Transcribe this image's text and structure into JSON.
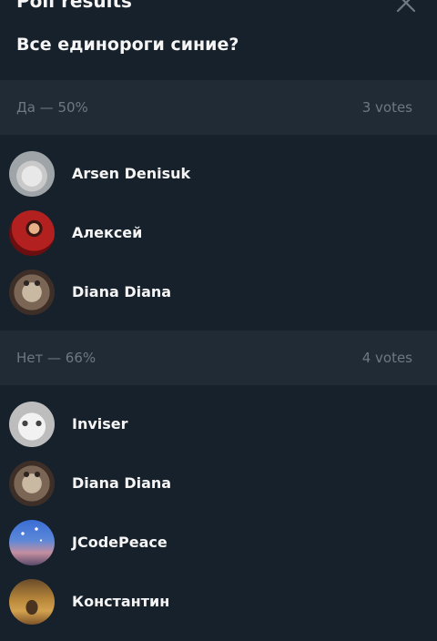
{
  "header": {
    "title": "Poll results",
    "question": "Все единороги синие?"
  },
  "sections": [
    {
      "option_label": "Да — 50%",
      "votes_label": "3 votes",
      "voters": [
        {
          "name": "Arsen Denisuk",
          "avatar": "avatar-arsen"
        },
        {
          "name": "Алексей",
          "avatar": "avatar-aleksey"
        },
        {
          "name": "Diana Diana",
          "avatar": "avatar-diana"
        }
      ]
    },
    {
      "option_label": "Нет — 66%",
      "votes_label": "4 votes",
      "voters": [
        {
          "name": "Inviser",
          "avatar": "avatar-inviser"
        },
        {
          "name": "Diana Diana",
          "avatar": "avatar-diana"
        },
        {
          "name": "JCodePeace",
          "avatar": "avatar-jcodepeace"
        },
        {
          "name": "Константин",
          "avatar": "avatar-konstantin"
        }
      ]
    }
  ],
  "colors": {
    "background": "#17212b",
    "section_header_bg": "#202b36",
    "primary_text": "#f5f5f5",
    "secondary_text": "#6d7883"
  }
}
